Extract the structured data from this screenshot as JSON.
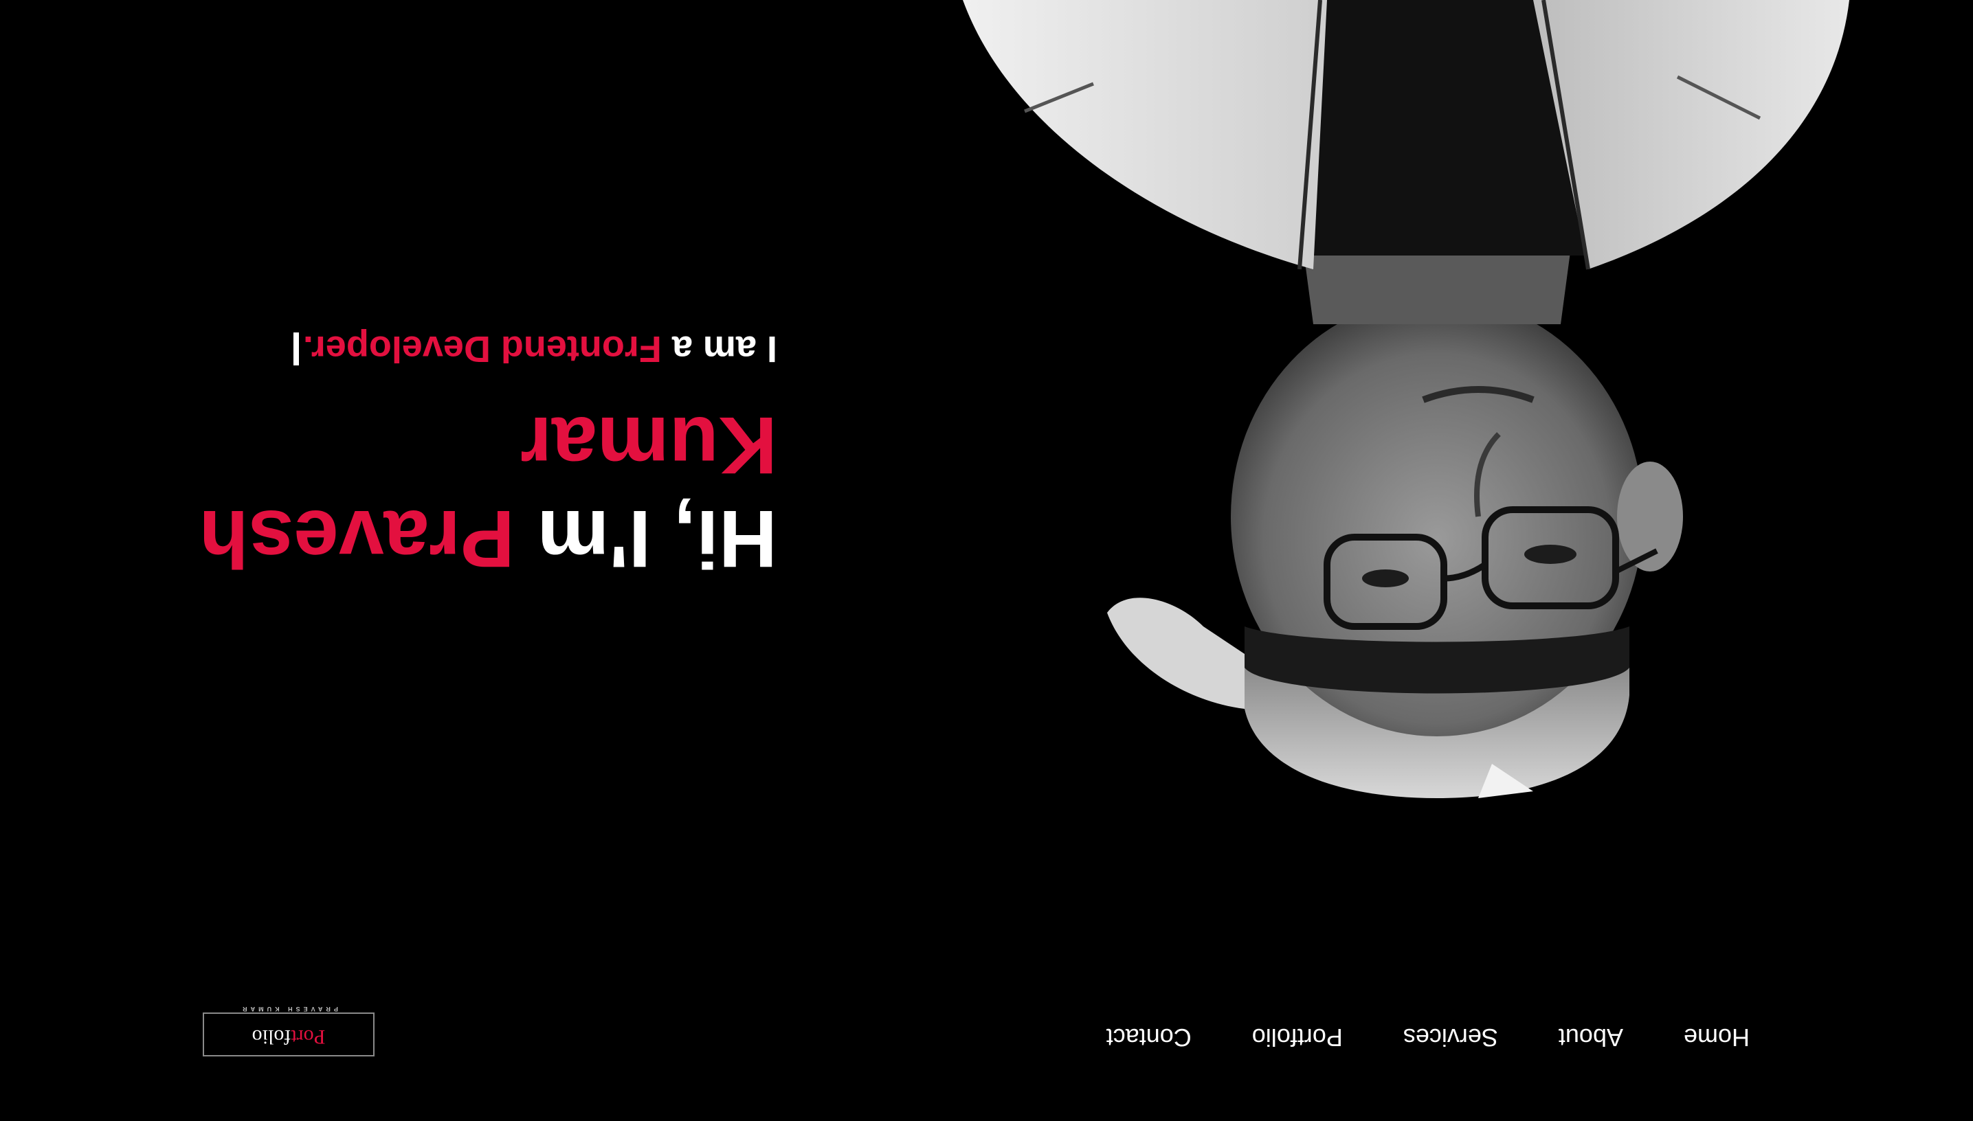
{
  "brand": {
    "logo_name_red": "Port",
    "logo_name_white": "folio",
    "logo_tagline": "PRAVESH KUMAR"
  },
  "nav": {
    "items": [
      {
        "label": "Home"
      },
      {
        "label": "About"
      },
      {
        "label": "Services"
      },
      {
        "label": "Portfolio"
      },
      {
        "label": "Contact"
      }
    ]
  },
  "hero": {
    "greeting": "Hi, I'm ",
    "name": "Pravesh Kumar",
    "intro": "I am a ",
    "role": "Frontend Developer."
  },
  "colors": {
    "background": "#000000",
    "accent": "#e3103f",
    "text": "#ffffff"
  },
  "icons": {
    "caret": "text-cursor"
  }
}
